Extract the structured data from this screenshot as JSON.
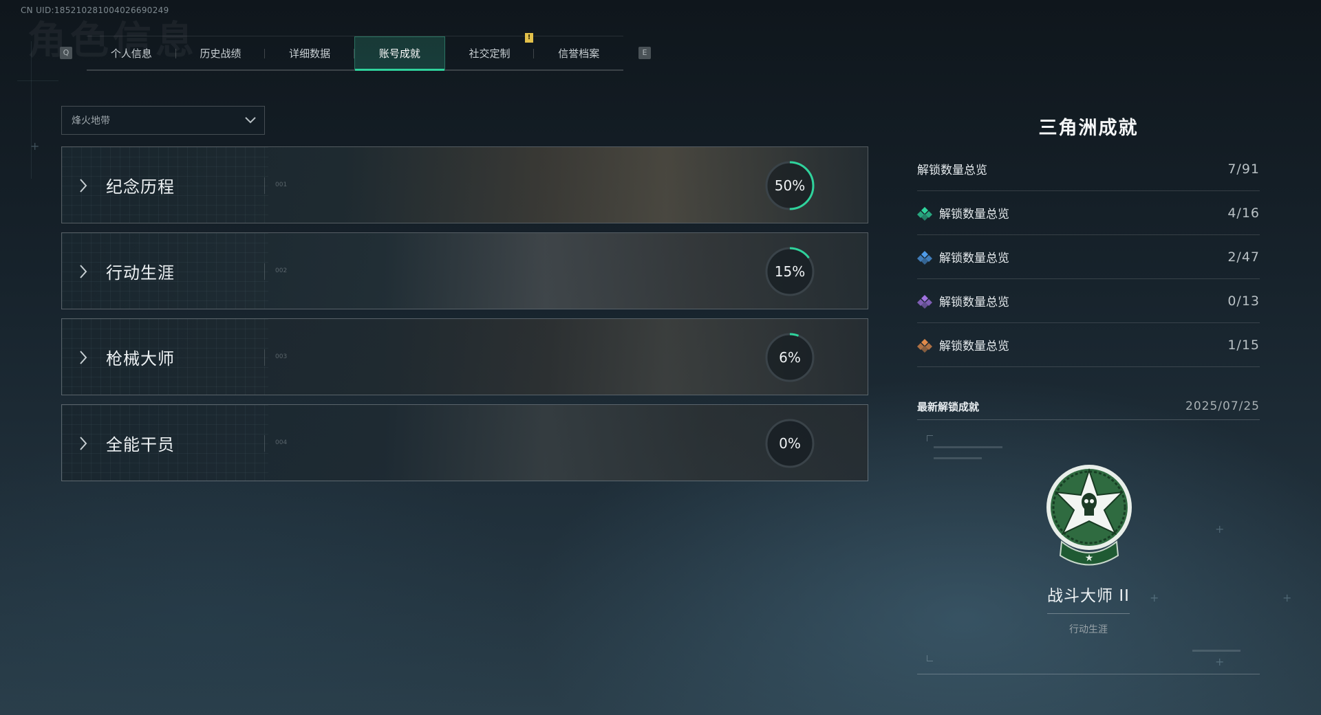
{
  "header": {
    "uid": "CN UID:1852102810040266902­49",
    "key_left": "Q",
    "key_right": "E",
    "notice": "!",
    "tabs": [
      {
        "label": "个人信息",
        "active": false
      },
      {
        "label": "历史战绩",
        "active": false
      },
      {
        "label": "详细数据",
        "active": false
      },
      {
        "label": "账号成就",
        "active": true
      },
      {
        "label": "社交定制",
        "active": false
      },
      {
        "label": "信誉档案",
        "active": false
      }
    ]
  },
  "mode_select": {
    "value": "烽火地带"
  },
  "categories": [
    {
      "title": "纪念历程",
      "index": "001",
      "percent_label": "50%",
      "progress": 0.5
    },
    {
      "title": "行动生涯",
      "index": "002",
      "percent_label": "15%",
      "progress": 0.15
    },
    {
      "title": "枪械大师",
      "index": "003",
      "percent_label": "6%",
      "progress": 0.06
    },
    {
      "title": "全能干员",
      "index": "004",
      "percent_label": "0%",
      "progress": 0.0
    }
  ],
  "summary": {
    "title": "三角洲成就",
    "rows": [
      {
        "label": "解锁数量总览",
        "value": "7/91",
        "icon": "none",
        "color": ""
      },
      {
        "label": "解锁数量总览",
        "value": "4/16",
        "icon": "green-rarity-icon",
        "color": "#2fd39c"
      },
      {
        "label": "解锁数量总览",
        "value": "2/47",
        "icon": "blue-rarity-icon",
        "color": "#4f9be8"
      },
      {
        "label": "解锁数量总览",
        "value": "0/13",
        "icon": "purple-rarity-icon",
        "color": "#a072e0"
      },
      {
        "label": "解锁数量总览",
        "value": "1/15",
        "icon": "orange-rarity-icon",
        "color": "#e08a4a"
      }
    ]
  },
  "latest": {
    "label": "最新解锁成就",
    "date": "2025/07/25",
    "achievement": {
      "name": "战斗大师 II",
      "category": "行动生涯",
      "badge_icon": "combat-master-badge-icon"
    }
  },
  "colors": {
    "accent": "#2fd39c",
    "ring_track": "#3a4349"
  }
}
